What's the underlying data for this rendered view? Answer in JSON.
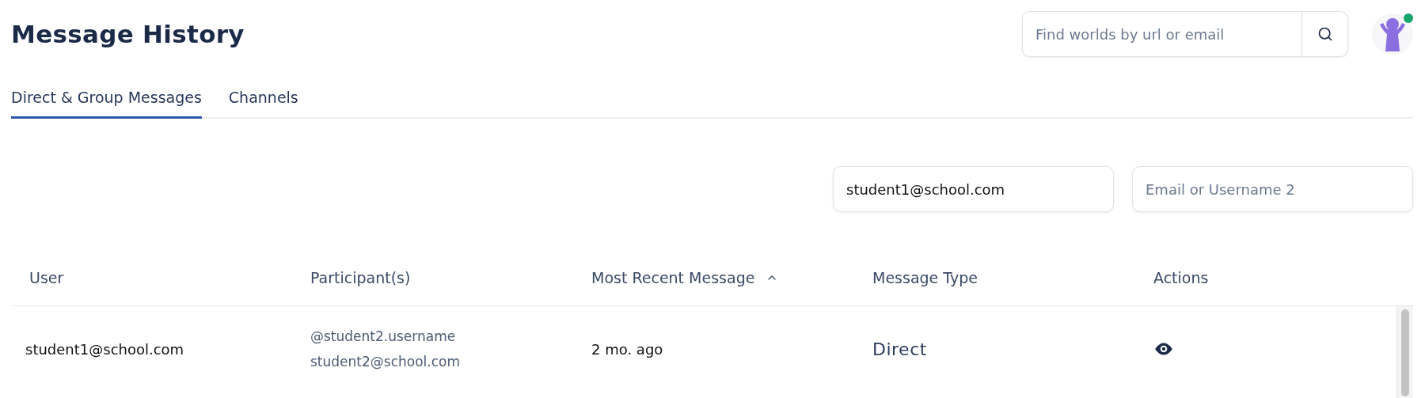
{
  "title": "Message History",
  "search": {
    "placeholder": "Find worlds by url or email"
  },
  "avatar": {
    "online": true
  },
  "tabs": [
    {
      "label": "Direct & Group Messages",
      "selected": true
    },
    {
      "label": "Channels",
      "selected": false
    }
  ],
  "filters": [
    {
      "value": "student1@school.com"
    },
    {
      "placeholder": "Email or Username 2"
    }
  ],
  "table": {
    "columns": [
      {
        "label": "User",
        "sorted": false
      },
      {
        "label": "Participant(s)",
        "sorted": false
      },
      {
        "label": "Most Recent Message",
        "sorted": true
      },
      {
        "label": "Message Type",
        "sorted": false
      },
      {
        "label": "Actions",
        "sorted": false
      }
    ],
    "rows": [
      {
        "user": "student1@school.com",
        "participants": [
          "@student2.username",
          "student2@school.com"
        ],
        "recent": "2 mo. ago",
        "type": "Direct"
      }
    ]
  }
}
